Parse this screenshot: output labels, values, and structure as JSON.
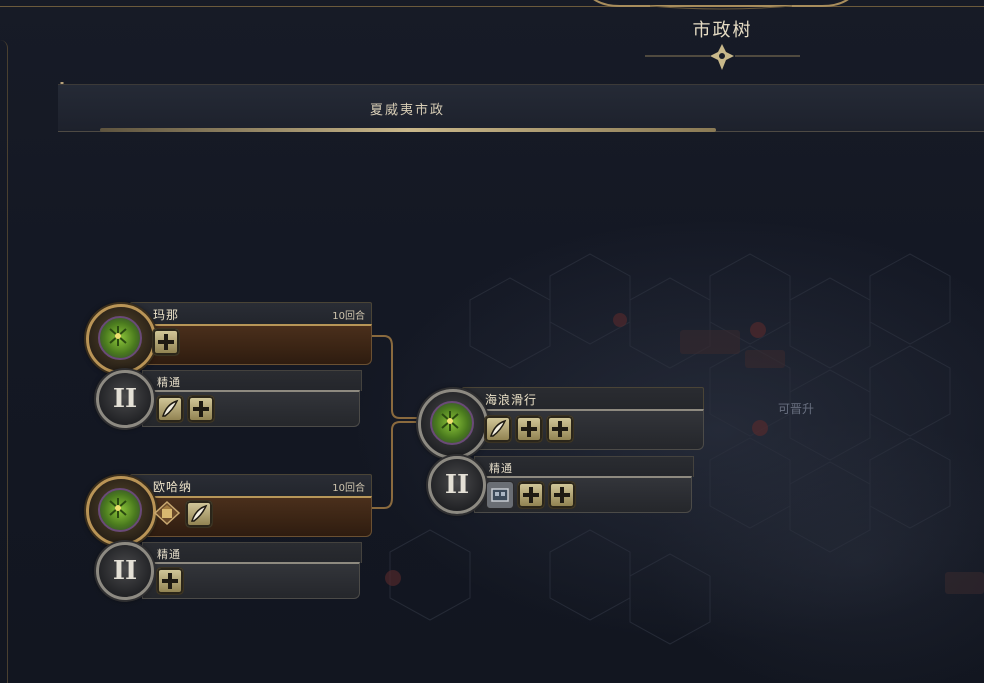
{
  "page": {
    "title": "市政树",
    "section_title": "夏威夷市政"
  },
  "map_labels": [
    "可晋升"
  ],
  "civics": [
    {
      "name": "玛那",
      "turns": "10回合",
      "icons": [
        "plus-icon"
      ],
      "mastery": {
        "label": "精通",
        "roman": "II",
        "icons": [
          "quill-icon",
          "plus-icon"
        ]
      }
    },
    {
      "name": "欧哈纳",
      "turns": "10回合",
      "icons": [
        "district-icon",
        "quill-icon"
      ],
      "mastery": {
        "label": "精通",
        "roman": "II",
        "icons": [
          "plus-icon"
        ]
      }
    },
    {
      "name": "海浪滑行",
      "turns": "",
      "icons": [
        "quill-icon",
        "plus-icon",
        "plus-icon"
      ],
      "mastery": {
        "label": "精通",
        "roman": "II",
        "icons": [
          "building-icon",
          "plus-icon",
          "plus-icon"
        ]
      }
    }
  ],
  "colors": {
    "accent_gold": "#b99456",
    "card_brown": "#3a2414",
    "medal_green": "#8cc53a",
    "background": "#151924"
  }
}
